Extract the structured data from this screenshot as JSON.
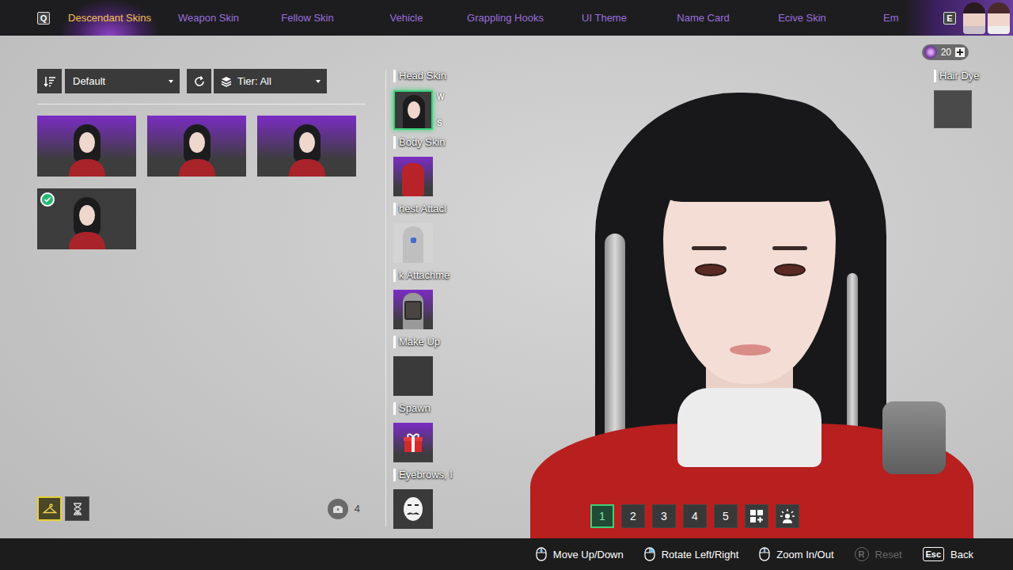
{
  "top_nav": {
    "prev_key": "Q",
    "next_key": "E",
    "tabs": [
      {
        "label": "Descendant Skins",
        "selected": true
      },
      {
        "label": "Weapon Skin",
        "selected": false
      },
      {
        "label": "Fellow Skin",
        "selected": false
      },
      {
        "label": "Vehicle",
        "selected": false
      },
      {
        "label": "Grappling Hooks",
        "selected": false
      },
      {
        "label": "UI Theme",
        "selected": false
      },
      {
        "label": "Name Card",
        "selected": false
      },
      {
        "label": "Ecive Skin",
        "selected": false
      },
      {
        "label": "Em",
        "selected": false
      }
    ]
  },
  "currency": {
    "amount": "20"
  },
  "toolbar": {
    "sort": "Default",
    "tier": "Tier: All"
  },
  "skins": [
    {
      "color": "#7b2cc4",
      "equipped": false
    },
    {
      "color": "#7b2cc4",
      "equipped": false
    },
    {
      "color": "#7b2cc4",
      "equipped": false
    },
    {
      "color": "#3c3c3c",
      "equipped": true
    }
  ],
  "view_filters": [
    {
      "kind": "wardrobe",
      "selected": true
    },
    {
      "kind": "timed",
      "selected": false
    }
  ],
  "storage": {
    "count": "4"
  },
  "slots": [
    {
      "label": "Head Skin",
      "kind": "head",
      "selected": true,
      "keys": [
        "W",
        "S"
      ]
    },
    {
      "label": "Body Skin",
      "kind": "body",
      "selected": false,
      "keys": []
    },
    {
      "label": "hest Attacl",
      "kind": "chest",
      "selected": false,
      "keys": []
    },
    {
      "label": "k Attachme",
      "kind": "back",
      "selected": false,
      "keys": []
    },
    {
      "label": "Make Up",
      "kind": "empty",
      "selected": false,
      "keys": []
    },
    {
      "label": "Spawn",
      "kind": "spawn",
      "selected": false,
      "keys": []
    },
    {
      "label": "Eyebrows, I",
      "kind": "face",
      "selected": false,
      "keys": []
    }
  ],
  "hair_dye": {
    "label": "Hair Dye"
  },
  "presets": [
    {
      "label": "1",
      "selected": true
    },
    {
      "label": "2",
      "selected": false
    },
    {
      "label": "3",
      "selected": false
    },
    {
      "label": "4",
      "selected": false
    },
    {
      "label": "5",
      "selected": false
    }
  ],
  "preset_tools": [
    {
      "kind": "add"
    },
    {
      "kind": "lighting"
    }
  ],
  "controls": [
    {
      "kind": "mouse-middle",
      "key": "",
      "label": "Move Up/Down",
      "disabled": false
    },
    {
      "kind": "mouse-right",
      "key": "",
      "label": "Rotate Left/Right",
      "disabled": false
    },
    {
      "kind": "mouse-wheel",
      "key": "",
      "label": "Zoom In/Out",
      "disabled": false
    },
    {
      "kind": "key",
      "key": "R",
      "label": "Reset",
      "disabled": true
    },
    {
      "kind": "key",
      "key": "Esc",
      "label": "Back",
      "disabled": false
    }
  ]
}
